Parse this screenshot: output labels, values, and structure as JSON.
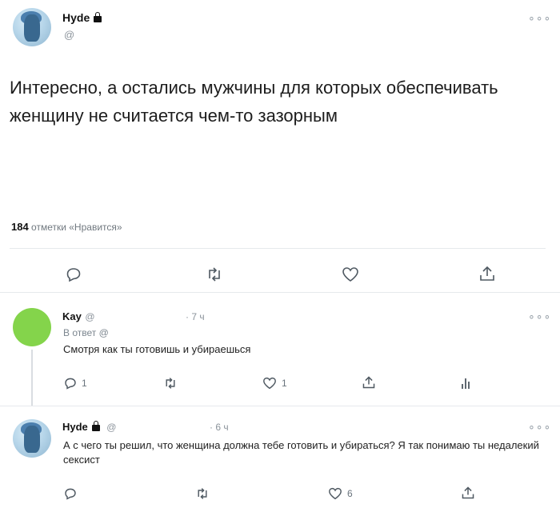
{
  "main_tweet": {
    "name": "Hyde",
    "handle": "@",
    "text": "Интересно, а остались мужчины для которых обеспечивать женщину не считается чем-то зазорным",
    "likes_count": "184",
    "likes_label": "отметки «Нравится»"
  },
  "replies": [
    {
      "name": "Kay",
      "handle": "@",
      "time": "· 7 ч",
      "reply_to": "В ответ @",
      "text": "Смотря как ты готовишь и убираешься",
      "reply_count": "1",
      "like_count": "1"
    },
    {
      "name": "Hyde",
      "handle": "@",
      "time": "· 6 ч",
      "text": "А с чего ты решил, что женщина должна тебе готовить и убираться? Я так понимаю ты недалекий сексист",
      "like_count": "6"
    }
  ],
  "icons": {
    "more": "more-icon",
    "reply": "reply-icon",
    "retweet": "retweet-icon",
    "like": "heart-icon",
    "share": "share-icon",
    "analytics": "analytics-icon",
    "lock": "lock-icon"
  },
  "colors": {
    "text": "#1c1c1c",
    "muted": "#70787f",
    "green_avatar": "#84d44b"
  }
}
